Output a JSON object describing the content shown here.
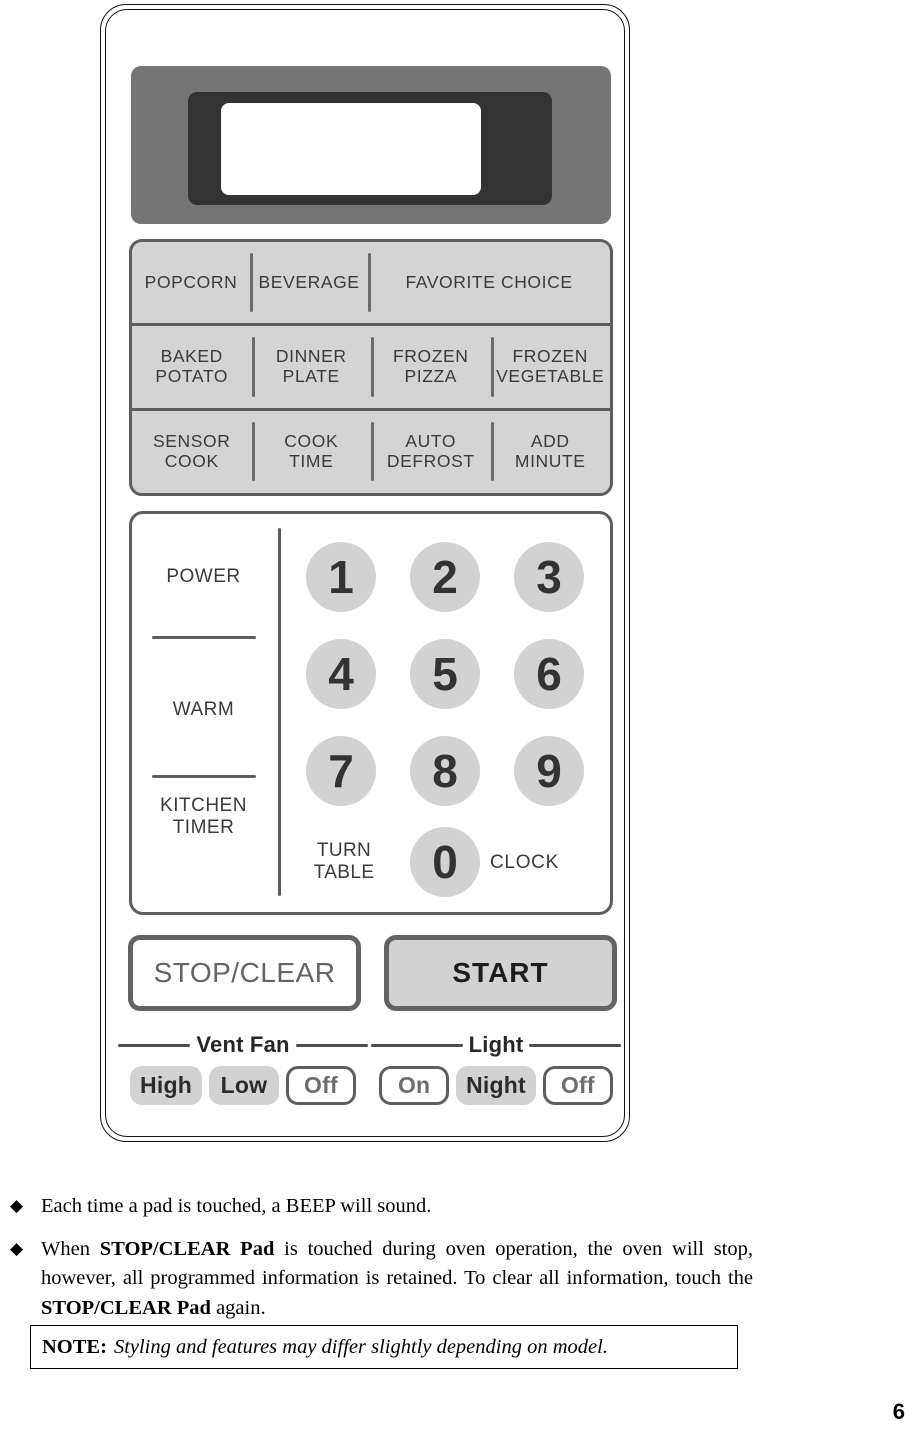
{
  "page": {
    "number": "6"
  },
  "control_panel": {
    "display": {
      "label": "display-window"
    },
    "function_pad": {
      "rows": [
        {
          "cells": [
            {
              "line1": "POPCORN"
            },
            {
              "line1": "BEVERAGE"
            },
            {
              "line1": "FAVORITE CHOICE",
              "wide": true
            }
          ]
        },
        {
          "cells": [
            {
              "line1": "BAKED",
              "line2": "POTATO"
            },
            {
              "line1": "DINNER",
              "line2": "PLATE"
            },
            {
              "line1": "FROZEN",
              "line2": "PIZZA"
            },
            {
              "line1": "FROZEN",
              "line2": "VEGETABLE"
            }
          ]
        },
        {
          "cells": [
            {
              "line1": "SENSOR",
              "line2": "COOK"
            },
            {
              "line1": "COOK",
              "line2": "TIME"
            },
            {
              "line1": "AUTO",
              "line2": "DEFROST"
            },
            {
              "line1": "ADD",
              "line2": "MINUTE"
            }
          ]
        }
      ]
    },
    "keypad": {
      "left_labels": {
        "power": "POWER",
        "warm": "WARM",
        "kitchen_timer_line1": "KITCHEN",
        "kitchen_timer_line2": "TIMER"
      },
      "numbers": [
        "1",
        "2",
        "3",
        "4",
        "5",
        "6",
        "7",
        "8",
        "9",
        "0"
      ],
      "turntable_line1": "TURN",
      "turntable_line2": "TABLE",
      "clock": "CLOCK"
    },
    "actions": {
      "stop_clear": "STOP/CLEAR",
      "start": "START"
    },
    "toggles": [
      {
        "title": "Vent Fan",
        "options": [
          {
            "label": "High",
            "state": "filled"
          },
          {
            "label": "Low",
            "state": "filled"
          },
          {
            "label": "Off",
            "state": "outlined"
          }
        ]
      },
      {
        "title": "Light",
        "options": [
          {
            "label": "On",
            "state": "outlined"
          },
          {
            "label": "Night",
            "state": "filled"
          },
          {
            "label": "Off",
            "state": "outlined"
          }
        ]
      }
    ]
  },
  "notes": {
    "bullet_glyph": "◆",
    "item1": "Each time a pad is touched, a BEEP will sound.",
    "item2_part1": "When ",
    "item2_bold1": "STOP/CLEAR Pad",
    "item2_part2": " is touched during oven operation, the oven will stop, however, all programmed information is retained. To clear all information, touch the ",
    "item2_bold2": "STOP/CLEAR Pad",
    "item2_part3": " again.",
    "note_label": "NOTE:",
    "note_text": "Styling and features may differ slightly depending on model."
  },
  "colors": {
    "pad_fill": "#d4d4d4",
    "pad_border": "#5e5e5e",
    "key_fill": "#d2d2d2",
    "bezel": "#757575",
    "frame": "#333333",
    "text_gray": "#3a3a3a"
  }
}
